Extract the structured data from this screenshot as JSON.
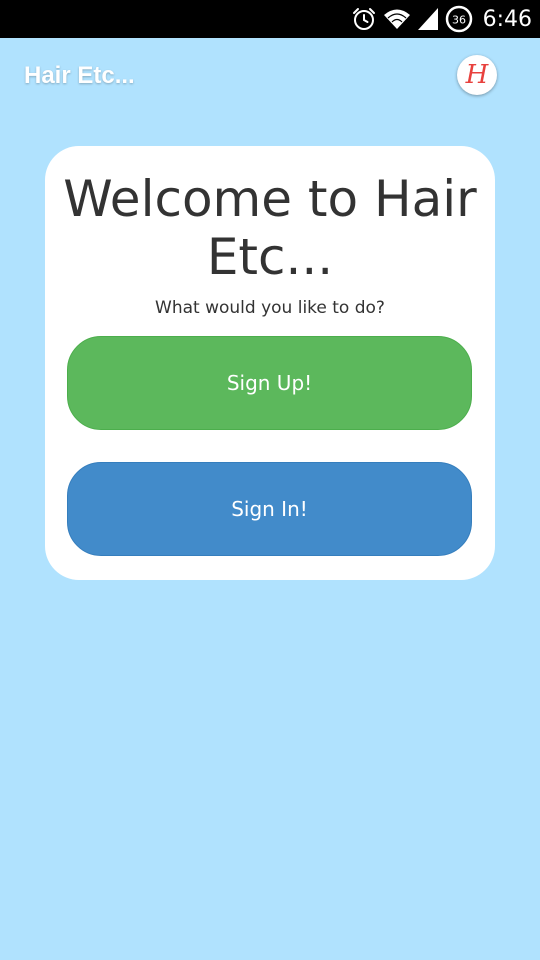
{
  "status_bar": {
    "time": "6:46",
    "battery_level": "36",
    "icons": [
      "alarm-icon",
      "wifi-icon",
      "signal-icon",
      "battery-icon"
    ]
  },
  "app_bar": {
    "title": "Hair Etc...",
    "logo_letter": "H"
  },
  "welcome_card": {
    "heading": "Welcome to Hair Etc...",
    "prompt": "What would you like to do?",
    "signup_label": "Sign Up!",
    "signin_label": "Sign In!"
  },
  "colors": {
    "background": "#b0e2fe",
    "signup_button": "#5cb85c",
    "signin_button": "#428bca",
    "logo_accent": "#e8413d"
  }
}
